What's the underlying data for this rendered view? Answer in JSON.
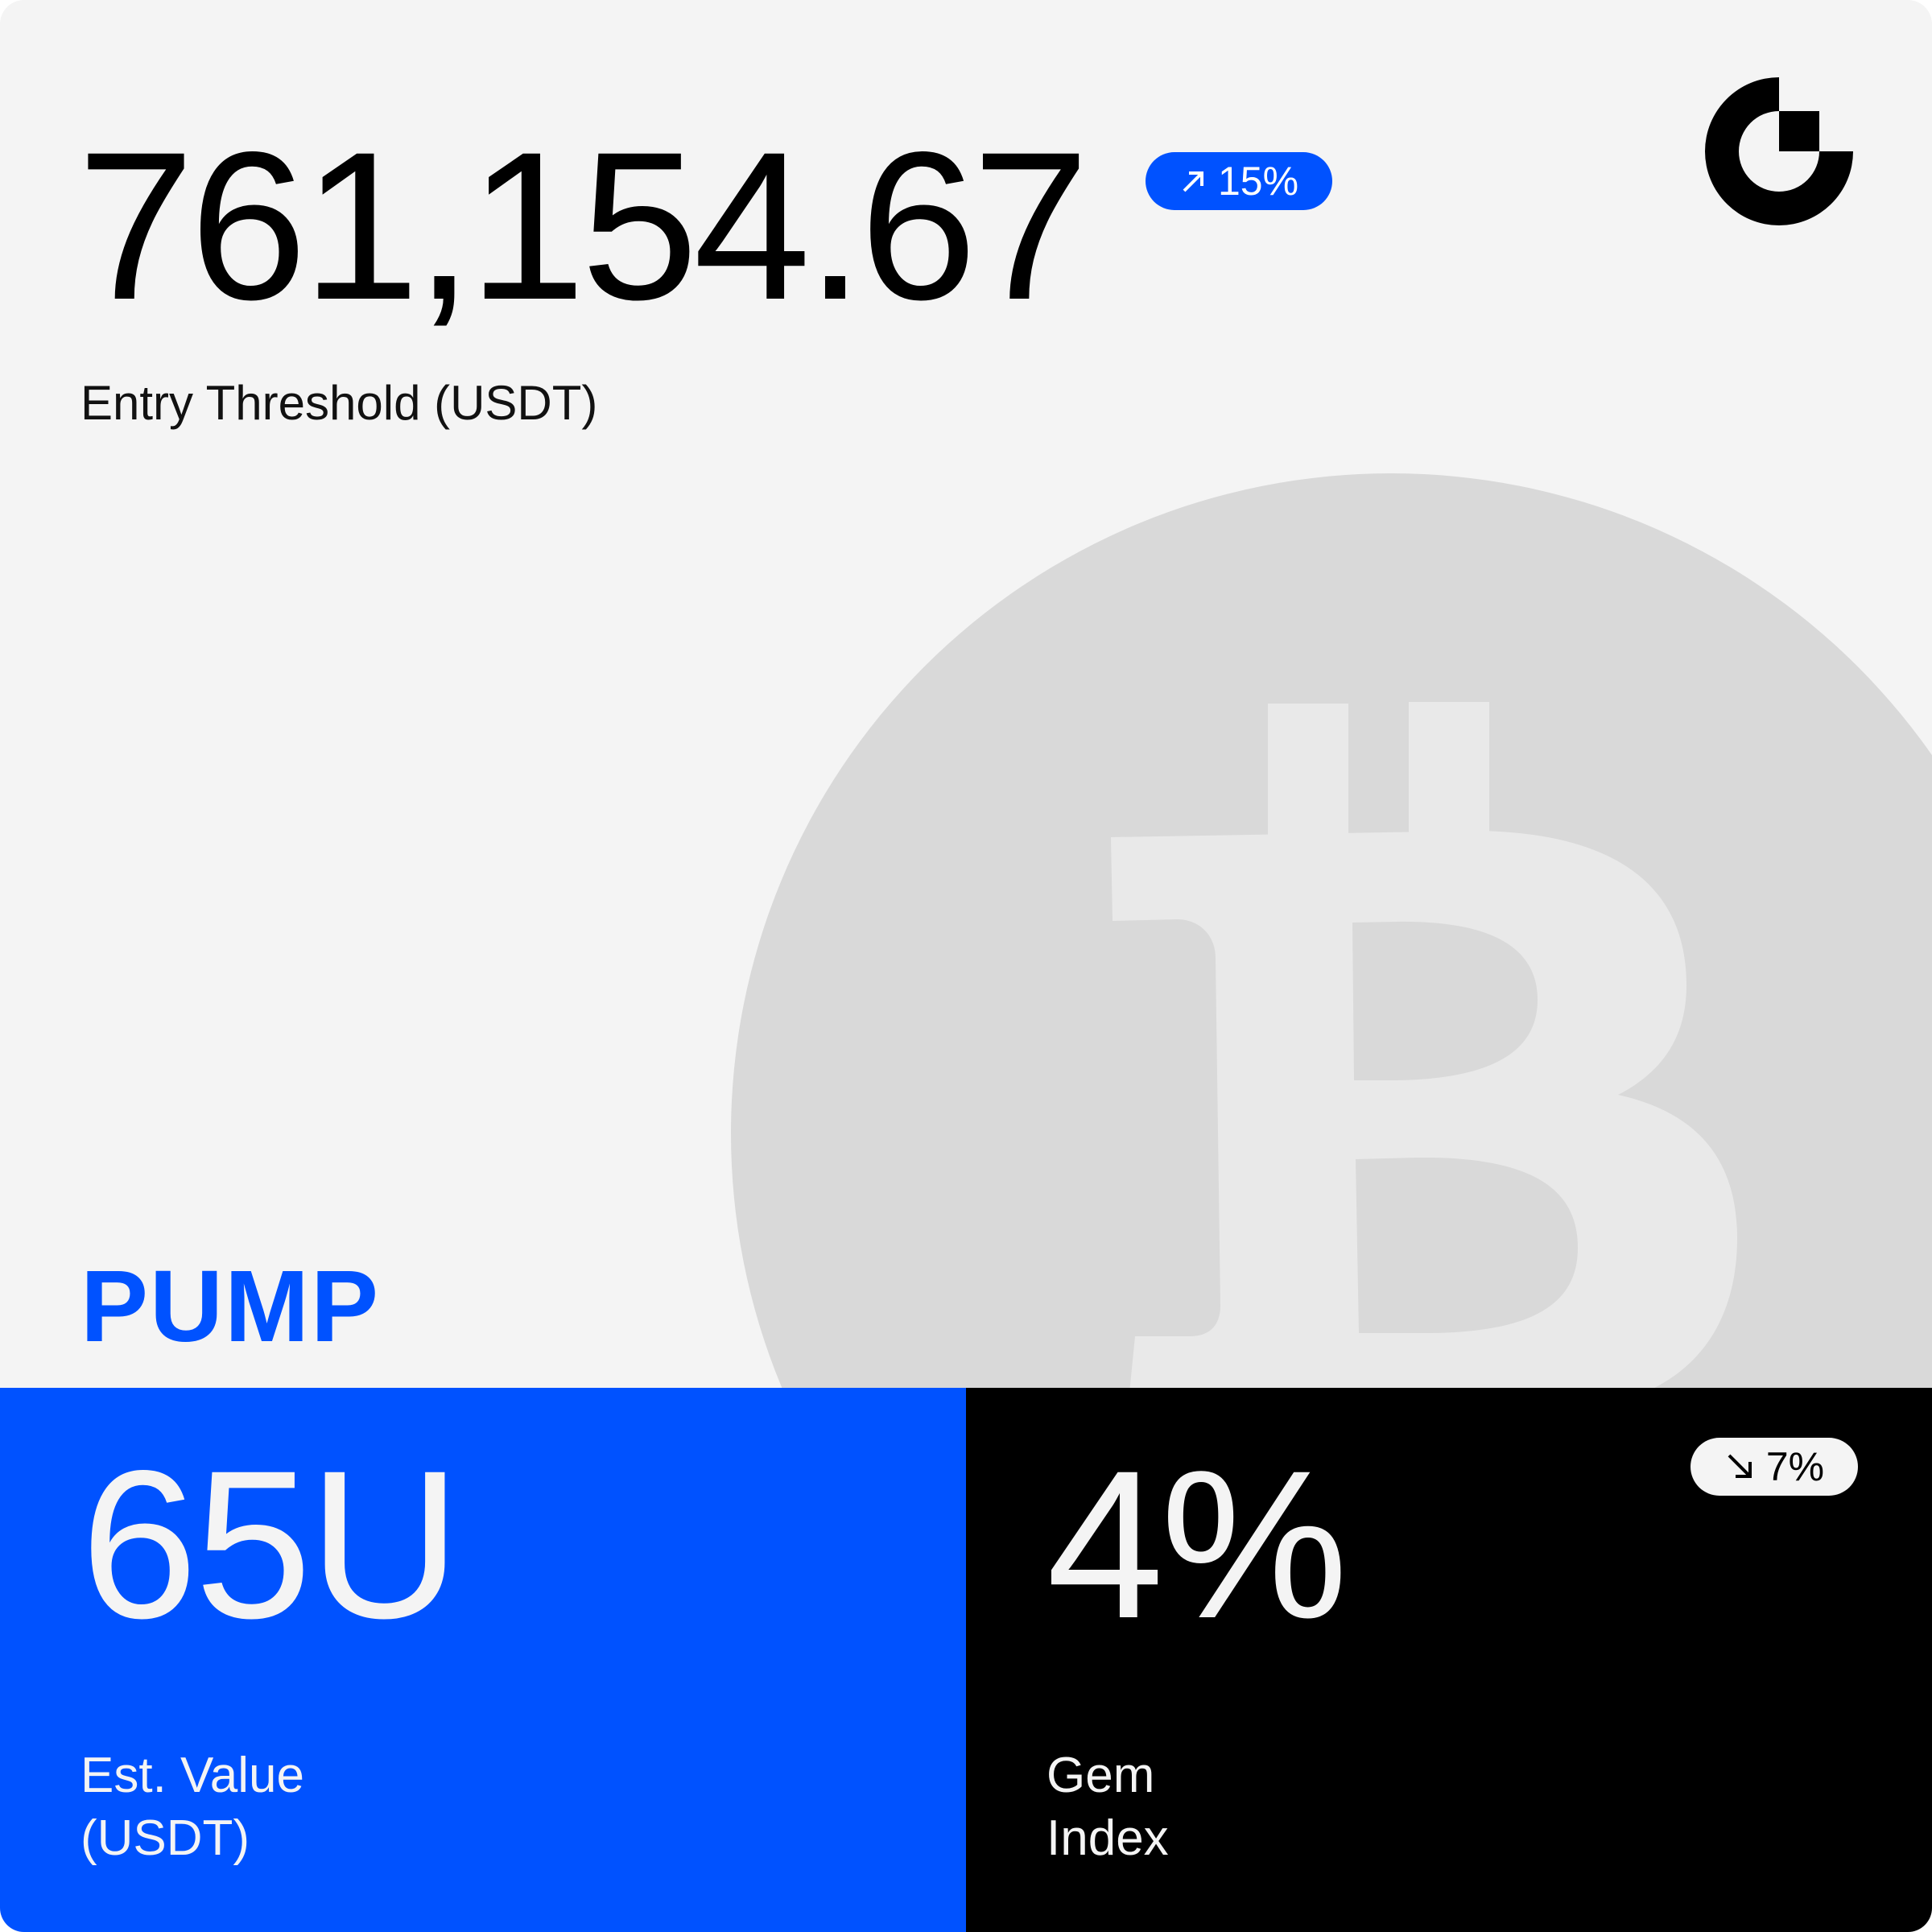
{
  "threshold": {
    "value": "761,154.67",
    "label": "Entry Threshold (USDT)",
    "change": "15%",
    "change_direction": "up",
    "change_icon": "arrow-up-right-icon",
    "change_color": "#0052ff"
  },
  "logo": {
    "icon": "brand-logo-icon"
  },
  "background": {
    "icon": "bitcoin-icon"
  },
  "token": {
    "name": "PUMP",
    "color": "#0052ff"
  },
  "est_value": {
    "value": "65U",
    "label_line1": "Est. Value",
    "label_line2": "(USDT)",
    "bg_color": "#0052ff"
  },
  "gem_index": {
    "value": "4%",
    "label_line1": "Gem",
    "label_line2": "Index",
    "change": "7%",
    "change_direction": "down",
    "change_icon": "arrow-down-right-icon",
    "bg_color": "#000000"
  }
}
